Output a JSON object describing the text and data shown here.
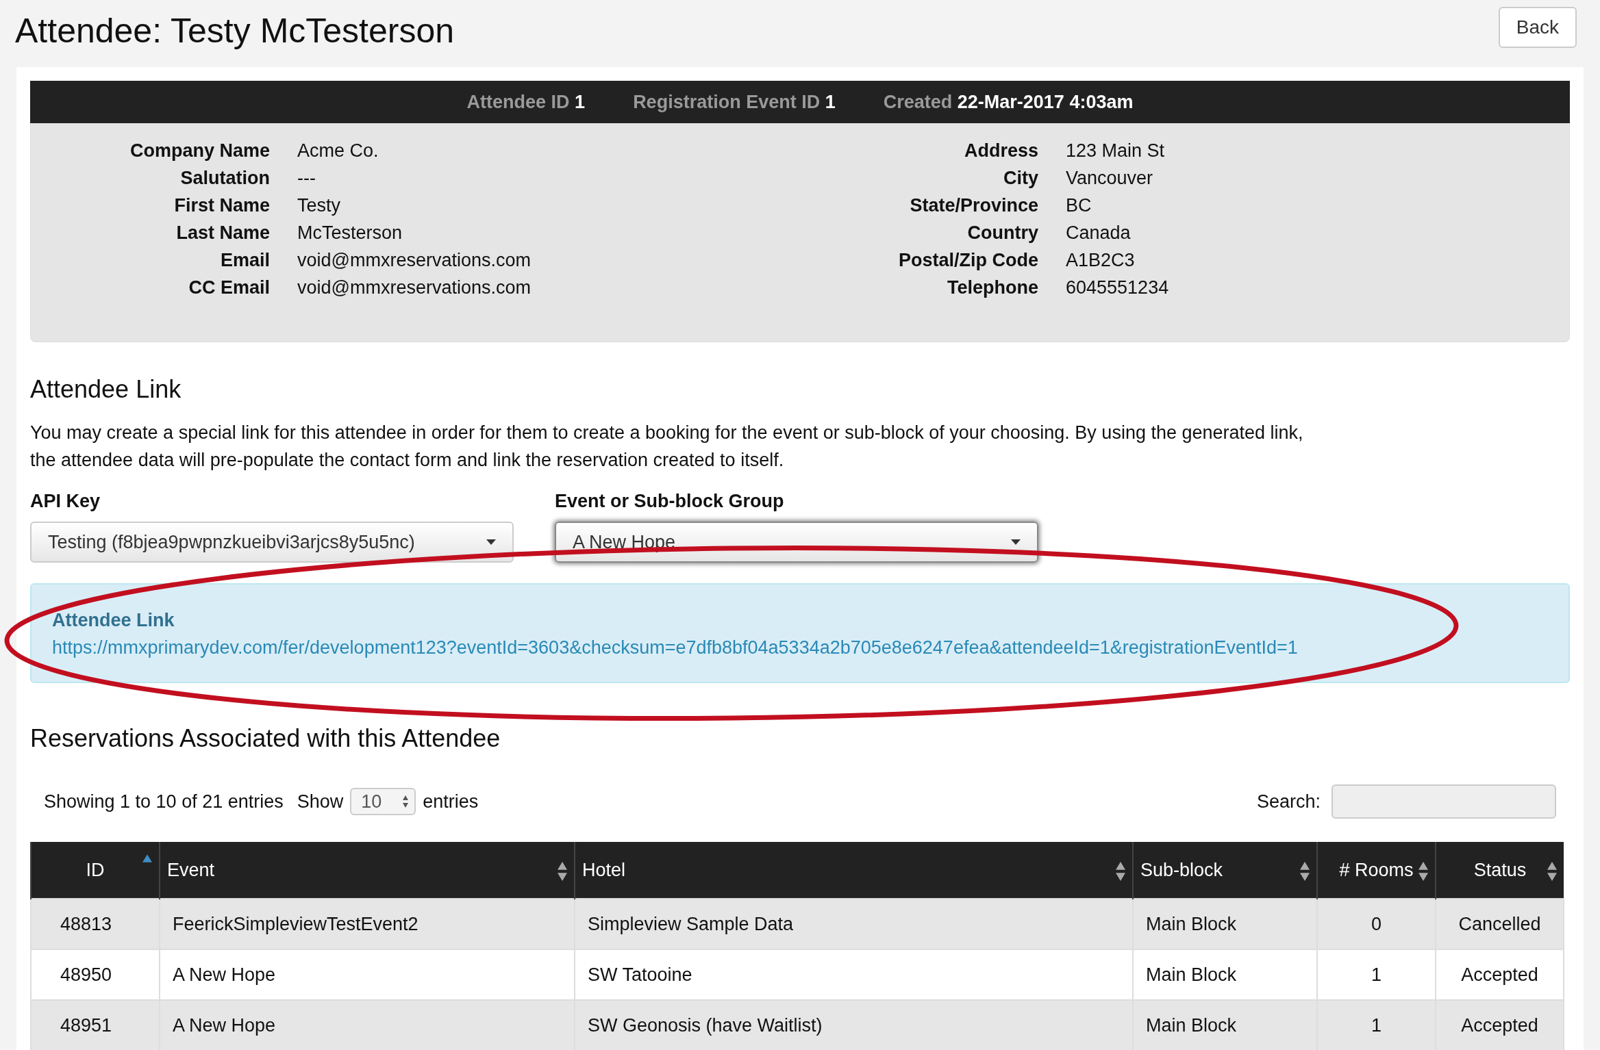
{
  "page": {
    "title": "Attendee: Testy McTesterson",
    "back_button": "Back"
  },
  "summary_bar": [
    {
      "label": "Attendee ID",
      "value": "1"
    },
    {
      "label": "Registration Event ID",
      "value": "1"
    },
    {
      "label": "Created",
      "value": "22-Mar-2017 4:03am"
    }
  ],
  "details": {
    "left": [
      {
        "label": "Company Name",
        "value": "Acme Co."
      },
      {
        "label": "Salutation",
        "value": "---"
      },
      {
        "label": "First Name",
        "value": "Testy"
      },
      {
        "label": "Last Name",
        "value": "McTesterson"
      },
      {
        "label": "Email",
        "value": "void@mmxreservations.com"
      },
      {
        "label": "CC Email",
        "value": "void@mmxreservations.com"
      }
    ],
    "right": [
      {
        "label": "Address",
        "value": "123 Main St"
      },
      {
        "label": "City",
        "value": "Vancouver"
      },
      {
        "label": "State/Province",
        "value": "BC"
      },
      {
        "label": "Country",
        "value": "Canada"
      },
      {
        "label": "Postal/Zip Code",
        "value": "A1B2C3"
      },
      {
        "label": "Telephone",
        "value": "6045551234"
      }
    ]
  },
  "attendee_link": {
    "heading": "Attendee Link",
    "description": "You may create a special link for this attendee in order for them to create a booking for the event or sub-block of your choosing. By using the generated link, the attendee data will pre-populate the contact form and link the reservation created to itself.",
    "selects": [
      {
        "label": "API Key",
        "value": "Testing (f8bjea9pwpnzkueibvi3arjcs8y5u5nc)",
        "focused": false
      },
      {
        "label": "Event or Sub-block Group",
        "value": "A New Hope",
        "focused": true
      }
    ],
    "result": {
      "title": "Attendee Link",
      "url": "https://mmxprimarydev.com/fer/development123?eventId=3603&checksum=e7dfb8bf04a5334a2b705e8e6247efea&attendeeId=1&registrationEventId=1"
    }
  },
  "reservations": {
    "heading": "Reservations Associated with this Attendee",
    "info": "Showing 1 to 10 of 21 entries",
    "show_label": "Show",
    "page_size": "10",
    "entries_label": "entries",
    "search_label": "Search:",
    "columns": [
      {
        "label": "ID",
        "sorted": true
      },
      {
        "label": "Event",
        "sorted": false
      },
      {
        "label": "Hotel",
        "sorted": false
      },
      {
        "label": "Sub-block",
        "sorted": false
      },
      {
        "label": "# Rooms",
        "sorted": false
      },
      {
        "label": "Status",
        "sorted": false
      }
    ],
    "rows": [
      [
        "48813",
        "FeerickSimpleviewTestEvent2",
        "Simpleview Sample Data",
        "Main Block",
        "0",
        "Cancelled"
      ],
      [
        "48950",
        "A New Hope",
        "SW Tatooine",
        "Main Block",
        "1",
        "Accepted"
      ],
      [
        "48951",
        "A New Hope",
        "SW Geonosis (have Waitlist)",
        "Main Block",
        "1",
        "Accepted"
      ]
    ]
  }
}
